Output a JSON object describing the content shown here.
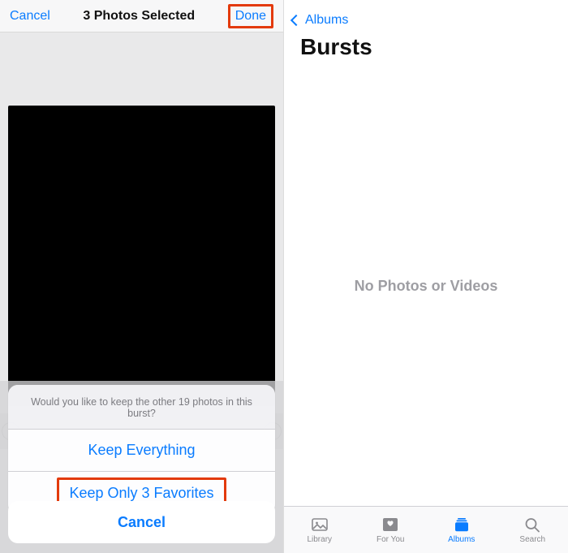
{
  "left": {
    "nav": {
      "cancel": "Cancel",
      "title": "3 Photos Selected",
      "done": "Done"
    },
    "sheet": {
      "message": "Would you like to keep the other 19 photos in this burst?",
      "keep_all": "Keep Everything",
      "keep_fav": "Keep Only 3 Favorites",
      "cancel": "Cancel"
    }
  },
  "right": {
    "back_label": "Albums",
    "title": "Bursts",
    "empty": "No Photos or Videos",
    "tabs": {
      "library": "Library",
      "foryou": "For You",
      "albums": "Albums",
      "search": "Search"
    }
  },
  "colors": {
    "ios_blue": "#0a7cff",
    "highlight": "#e33a0c"
  }
}
